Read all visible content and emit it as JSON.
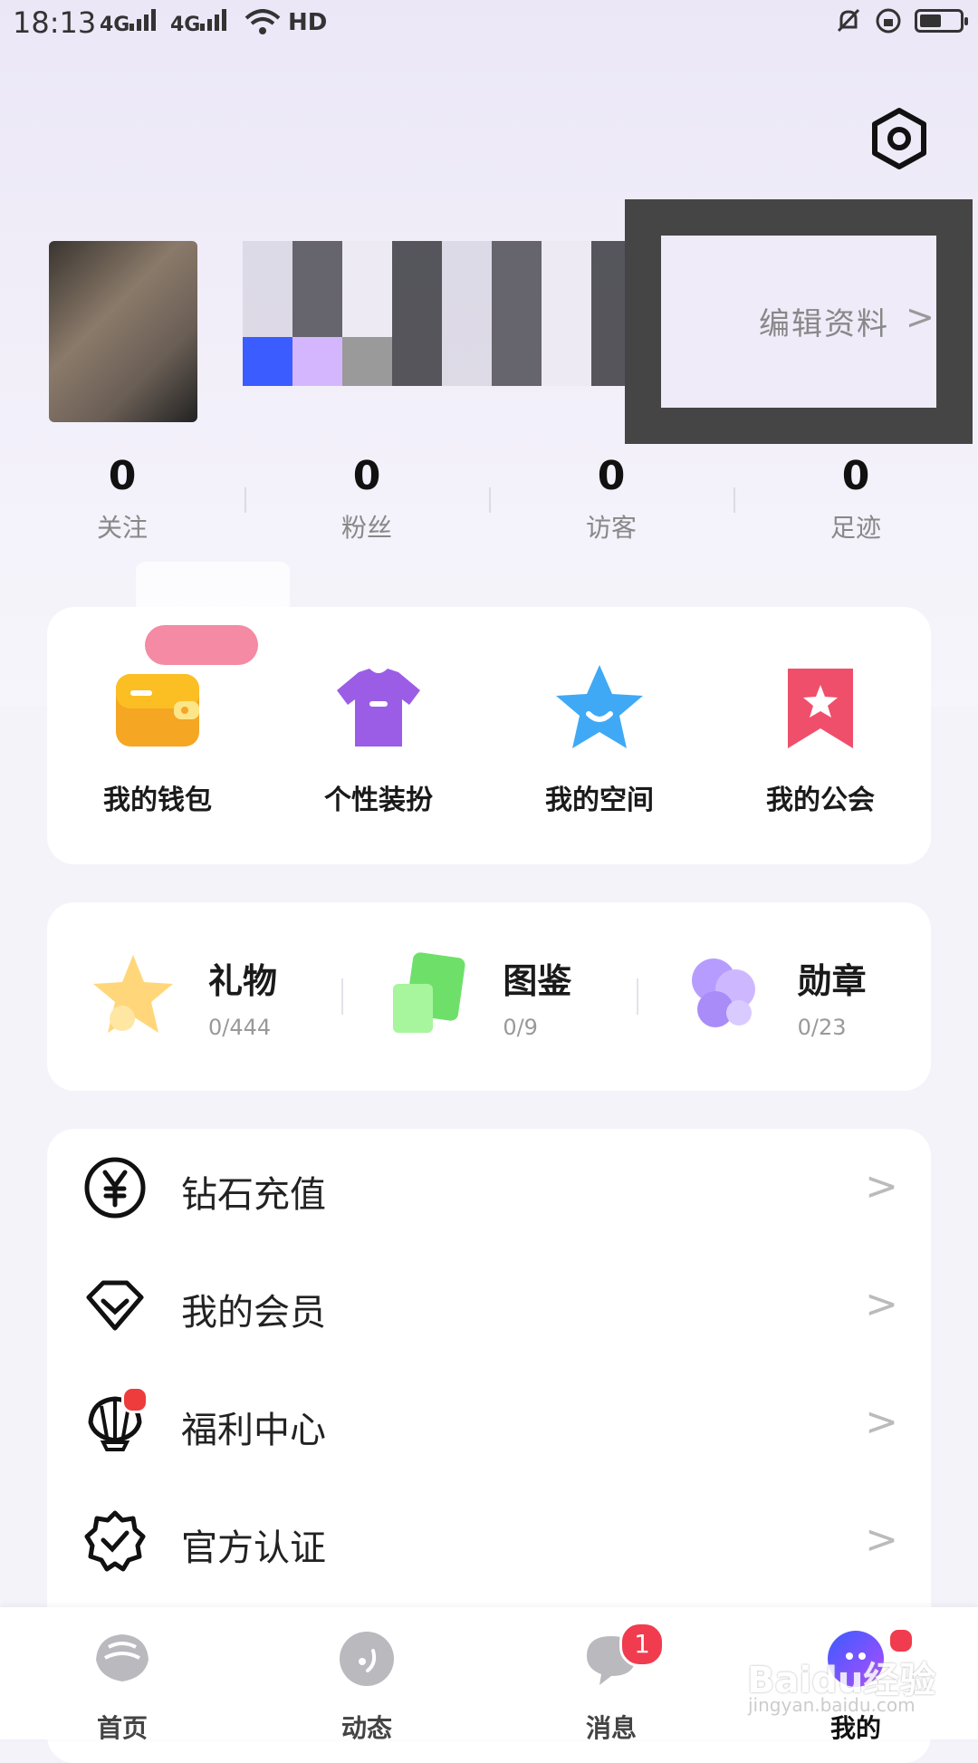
{
  "status_bar": {
    "time": "18:13",
    "net1": "4G",
    "net2": "4G",
    "hd": "HD",
    "battery_level": 0.55
  },
  "profile": {
    "edit_label": "编辑资料",
    "edit_arrow": ">"
  },
  "stats": [
    {
      "value": "0",
      "label": "关注"
    },
    {
      "value": "0",
      "label": "粉丝"
    },
    {
      "value": "0",
      "label": "访客"
    },
    {
      "value": "0",
      "label": "足迹"
    }
  ],
  "features": [
    {
      "label": "我的钱包",
      "icon": "wallet-icon"
    },
    {
      "label": "个性装扮",
      "icon": "tshirt-icon"
    },
    {
      "label": "我的空间",
      "icon": "star-smile-icon"
    },
    {
      "label": "我的公会",
      "icon": "bookmark-star-icon"
    }
  ],
  "collections": [
    {
      "title": "礼物",
      "count": "0/444",
      "icon": "gift-star-icon"
    },
    {
      "title": "图鉴",
      "count": "0/9",
      "icon": "cards-icon"
    },
    {
      "title": "勋章",
      "count": "0/23",
      "icon": "puzzle-icon"
    }
  ],
  "menu": [
    {
      "label": "钻石充值",
      "icon": "yen-circle-icon"
    },
    {
      "label": "我的会员",
      "icon": "diamond-icon"
    },
    {
      "label": "福利中心",
      "icon": "shell-icon"
    },
    {
      "label": "官方认证",
      "icon": "verified-badge-icon"
    }
  ],
  "chevron": ">",
  "tabs": [
    {
      "label": "首页",
      "icon": "home-shell-icon"
    },
    {
      "label": "动态",
      "icon": "moments-icon"
    },
    {
      "label": "消息",
      "icon": "chat-bubble-icon",
      "badge": "1"
    },
    {
      "label": "我的",
      "icon": "profile-icon"
    }
  ],
  "watermark": {
    "text": "Baidu经验",
    "sub": "jingyan.baidu.com"
  },
  "colors": {
    "accent": "#8a5cf6",
    "badge": "#f03c4e",
    "card": "#ffffff"
  }
}
